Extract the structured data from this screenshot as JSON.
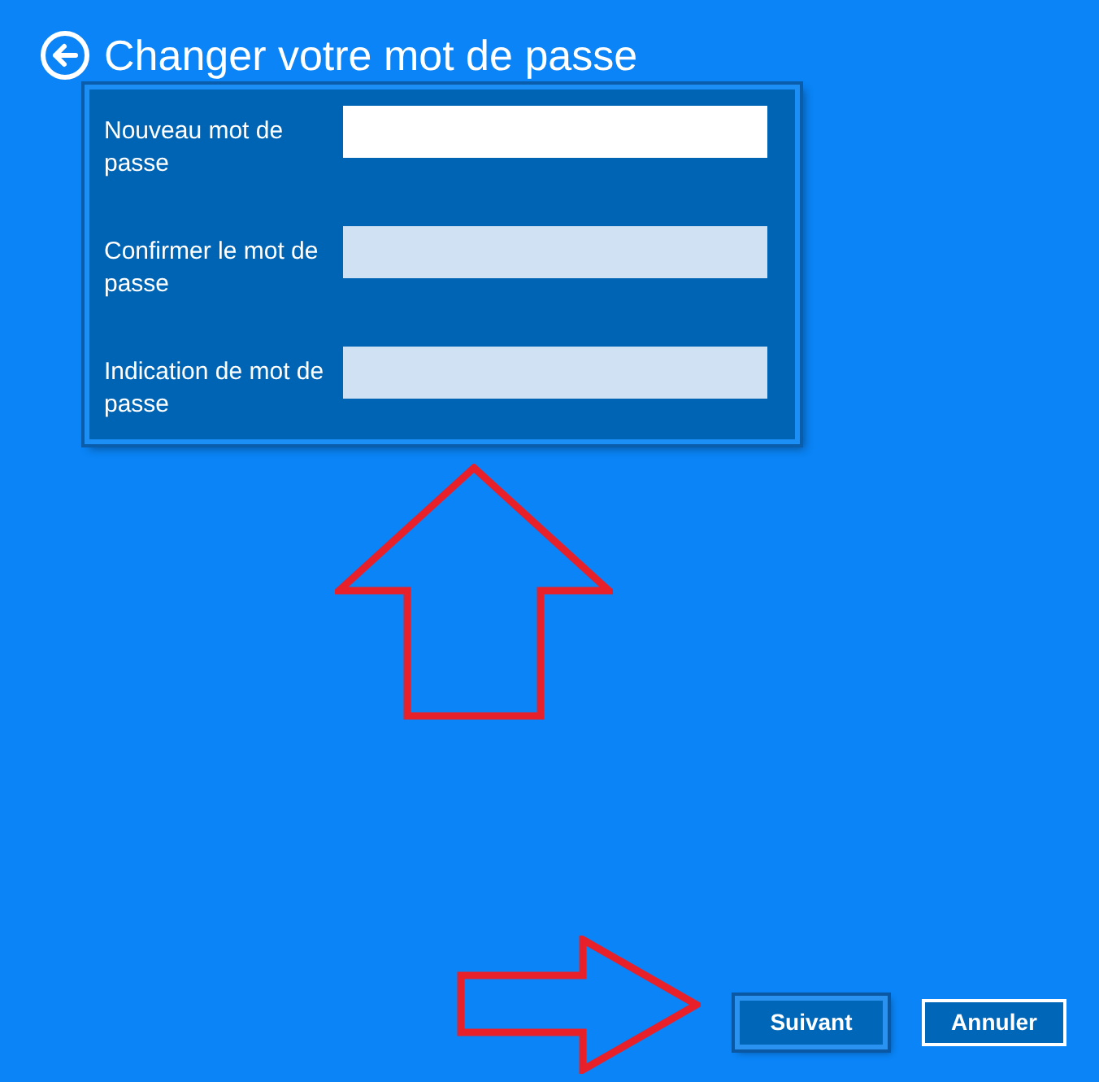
{
  "header": {
    "title": "Changer votre mot de passe"
  },
  "fields": [
    {
      "label": "Nouveau mot de passe",
      "disabled": false
    },
    {
      "label": "Confirmer le mot de passe",
      "disabled": true
    },
    {
      "label": "Indication de mot de passe",
      "disabled": true
    }
  ],
  "annotations": [
    {
      "kind": "arrow_up"
    },
    {
      "kind": "arrow_right"
    }
  ],
  "buttons": [
    {
      "label": "Suivant",
      "focused": true
    },
    {
      "label": "Annuler",
      "focused": false
    }
  ]
}
